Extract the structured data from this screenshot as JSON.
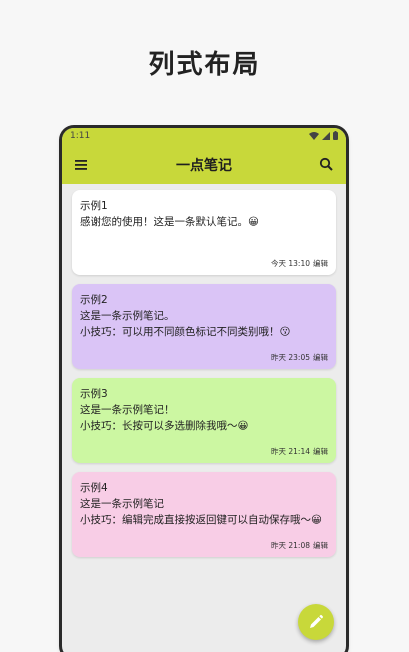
{
  "promo": {
    "title": "列式布局"
  },
  "status_bar": {
    "time": "1:11"
  },
  "app_bar": {
    "title": "一点笔记",
    "accent_color": "#c8d83a"
  },
  "notes": [
    {
      "title": "示例1",
      "lines": [
        "感谢您的使用！这是一条默认笔记。😀"
      ],
      "time": "今天 13:10",
      "action": "编辑",
      "color": "#ffffff"
    },
    {
      "title": "示例2",
      "lines": [
        "这是一条示例笔记。",
        "小技巧：可以用不同颜色标记不同类别哦！😗"
      ],
      "time": "昨天 23:05",
      "action": "编辑",
      "color": "#dac4f6"
    },
    {
      "title": "示例3",
      "lines": [
        "这是一条示例笔记！",
        "小技巧：长按可以多选删除我哦～😀"
      ],
      "time": "昨天 21:14",
      "action": "编辑",
      "color": "#ccf7a2"
    },
    {
      "title": "示例4",
      "lines": [
        "这是一条示例笔记",
        "小技巧：编辑完成直接按返回键可以自动保存哦～😀"
      ],
      "time": "昨天 21:08",
      "action": "编辑",
      "color": "#f8cde6"
    }
  ],
  "icons": {
    "menu": "menu-icon",
    "search": "search-icon",
    "fab": "edit-pencil-icon"
  }
}
